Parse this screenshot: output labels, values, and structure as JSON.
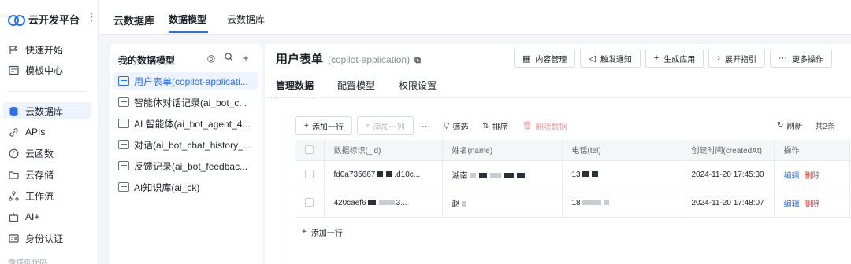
{
  "brand": {
    "name": "云开发平台",
    "more": "⋮"
  },
  "nav": {
    "items": [
      {
        "label": "快速开始",
        "icon": "flag-icon"
      },
      {
        "label": "模板中心",
        "icon": "template-icon"
      },
      {
        "label": "云数据库",
        "icon": "database-icon",
        "active": true
      },
      {
        "label": "APIs",
        "icon": "api-icon"
      },
      {
        "label": "云函数",
        "icon": "function-icon"
      },
      {
        "label": "云存储",
        "icon": "storage-icon"
      },
      {
        "label": "工作流",
        "icon": "workflow-icon"
      },
      {
        "label": "AI+",
        "icon": "ai-robot-icon"
      },
      {
        "label": "身份认证",
        "icon": "id-card-icon"
      }
    ],
    "footer": "微搭低代码"
  },
  "topbar": {
    "title": "云数据库",
    "tabs": [
      "数据模型",
      "云数据库"
    ]
  },
  "model_panel": {
    "title": "我的数据模型",
    "items": [
      "用户表单(copilot-applicati...",
      "智能体对话记录(ai_bot_c...",
      "AI 智能体(ai_bot_agent_4...",
      "对话(ai_bot_chat_history_...",
      "反馈记录(ai_bot_feedbac...",
      "AI知识库(ai_ck)"
    ]
  },
  "main": {
    "title": "用户表单",
    "subtitle": "(copilot-application)",
    "actions": [
      {
        "label": "内容管理",
        "icon": "content-manage-icon"
      },
      {
        "label": "触发通知",
        "icon": "send-icon"
      },
      {
        "label": "生成应用",
        "icon": "plus-icon"
      },
      {
        "label": "展开指引",
        "icon": "chevron-right-icon"
      },
      {
        "label": "更多操作",
        "icon": "more-icon"
      }
    ],
    "tabs": [
      "管理数据",
      "配置模型",
      "权限设置"
    ]
  },
  "toolbar": {
    "add_row": "添加一行",
    "add_col": "添加一列",
    "filter": "筛选",
    "sort": "排序",
    "delete": "删除数据",
    "refresh": "刷新",
    "count": "共2条"
  },
  "table": {
    "headers": [
      "数据标识(_id)",
      "姓名(name)",
      "电话(tel)",
      "创建时间(createdAt)",
      "操作"
    ],
    "rows": [
      {
        "id_prefix": "fd0a735667",
        "id_suffix": ".d10c...",
        "name": "湖南",
        "tel": "13",
        "created": "2024-11-20 17:45:30"
      },
      {
        "id_prefix": "420caef6",
        "id_suffix": "3...",
        "name": "赵",
        "tel": "18",
        "created": "2024-11-20 17:48:07"
      }
    ],
    "edit": "编辑",
    "delete": "删除",
    "add_row": "添加一行"
  },
  "colors": {
    "accent": "#2b6ef4",
    "danger": "#e3403b"
  }
}
